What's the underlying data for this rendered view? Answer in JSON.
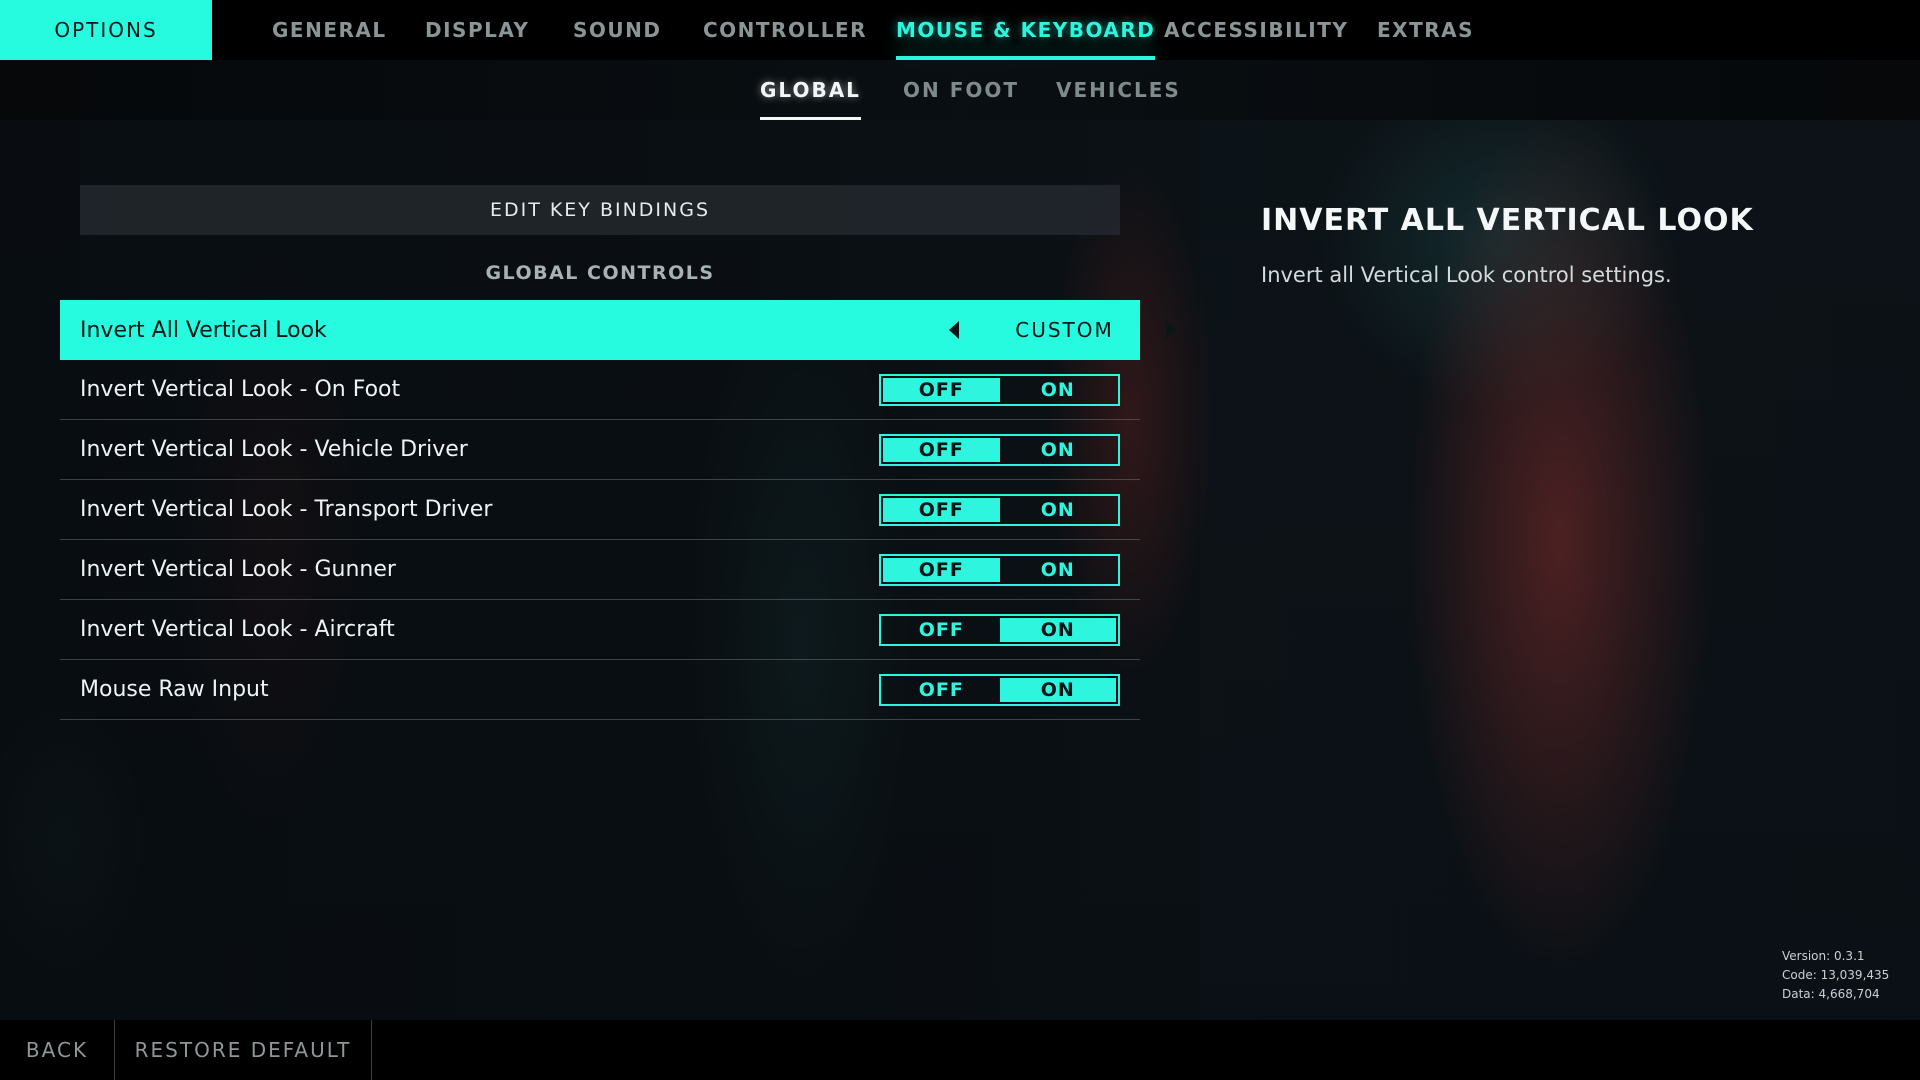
{
  "header": {
    "options_label": "OPTIONS",
    "tabs": [
      {
        "label": "GENERAL",
        "active": false
      },
      {
        "label": "DISPLAY",
        "active": false
      },
      {
        "label": "SOUND",
        "active": false
      },
      {
        "label": "CONTROLLER",
        "active": false
      },
      {
        "label": "MOUSE & KEYBOARD",
        "active": true
      },
      {
        "label": "ACCESSIBILITY",
        "active": false
      },
      {
        "label": "EXTRAS",
        "active": false
      }
    ]
  },
  "subnav": {
    "tabs": [
      {
        "label": "GLOBAL",
        "active": true
      },
      {
        "label": "ON FOOT",
        "active": false
      },
      {
        "label": "VEHICLES",
        "active": false
      }
    ]
  },
  "main": {
    "edit_key_bindings_label": "EDIT KEY BINDINGS",
    "section_title": "GLOBAL CONTROLS",
    "settings": [
      {
        "label": "Invert All Vertical Look",
        "type": "selector",
        "value": "CUSTOM",
        "selected": true
      },
      {
        "label": "Invert Vertical Look - On Foot",
        "type": "toggle",
        "value": "OFF"
      },
      {
        "label": "Invert Vertical Look - Vehicle Driver",
        "type": "toggle",
        "value": "OFF"
      },
      {
        "label": "Invert Vertical Look - Transport Driver",
        "type": "toggle",
        "value": "OFF"
      },
      {
        "label": "Invert Vertical Look - Gunner",
        "type": "toggle",
        "value": "OFF"
      },
      {
        "label": "Invert Vertical Look - Aircraft",
        "type": "toggle",
        "value": "ON"
      },
      {
        "label": "Mouse Raw Input",
        "type": "toggle",
        "value": "ON"
      }
    ],
    "toggle_labels": {
      "off": "OFF",
      "on": "ON"
    }
  },
  "info": {
    "title": "INVERT ALL VERTICAL LOOK",
    "description": "Invert all Vertical Look control settings."
  },
  "version_info": {
    "version": "Version: 0.3.1",
    "code": "Code: 13,039,435",
    "data": "Data: 4,668,704"
  },
  "footer": {
    "back_label": "BACK",
    "restore_label": "RESTORE DEFAULT"
  },
  "colors": {
    "accent": "#26fbe0",
    "background": "#0b1116",
    "text": "#eef3f3"
  }
}
